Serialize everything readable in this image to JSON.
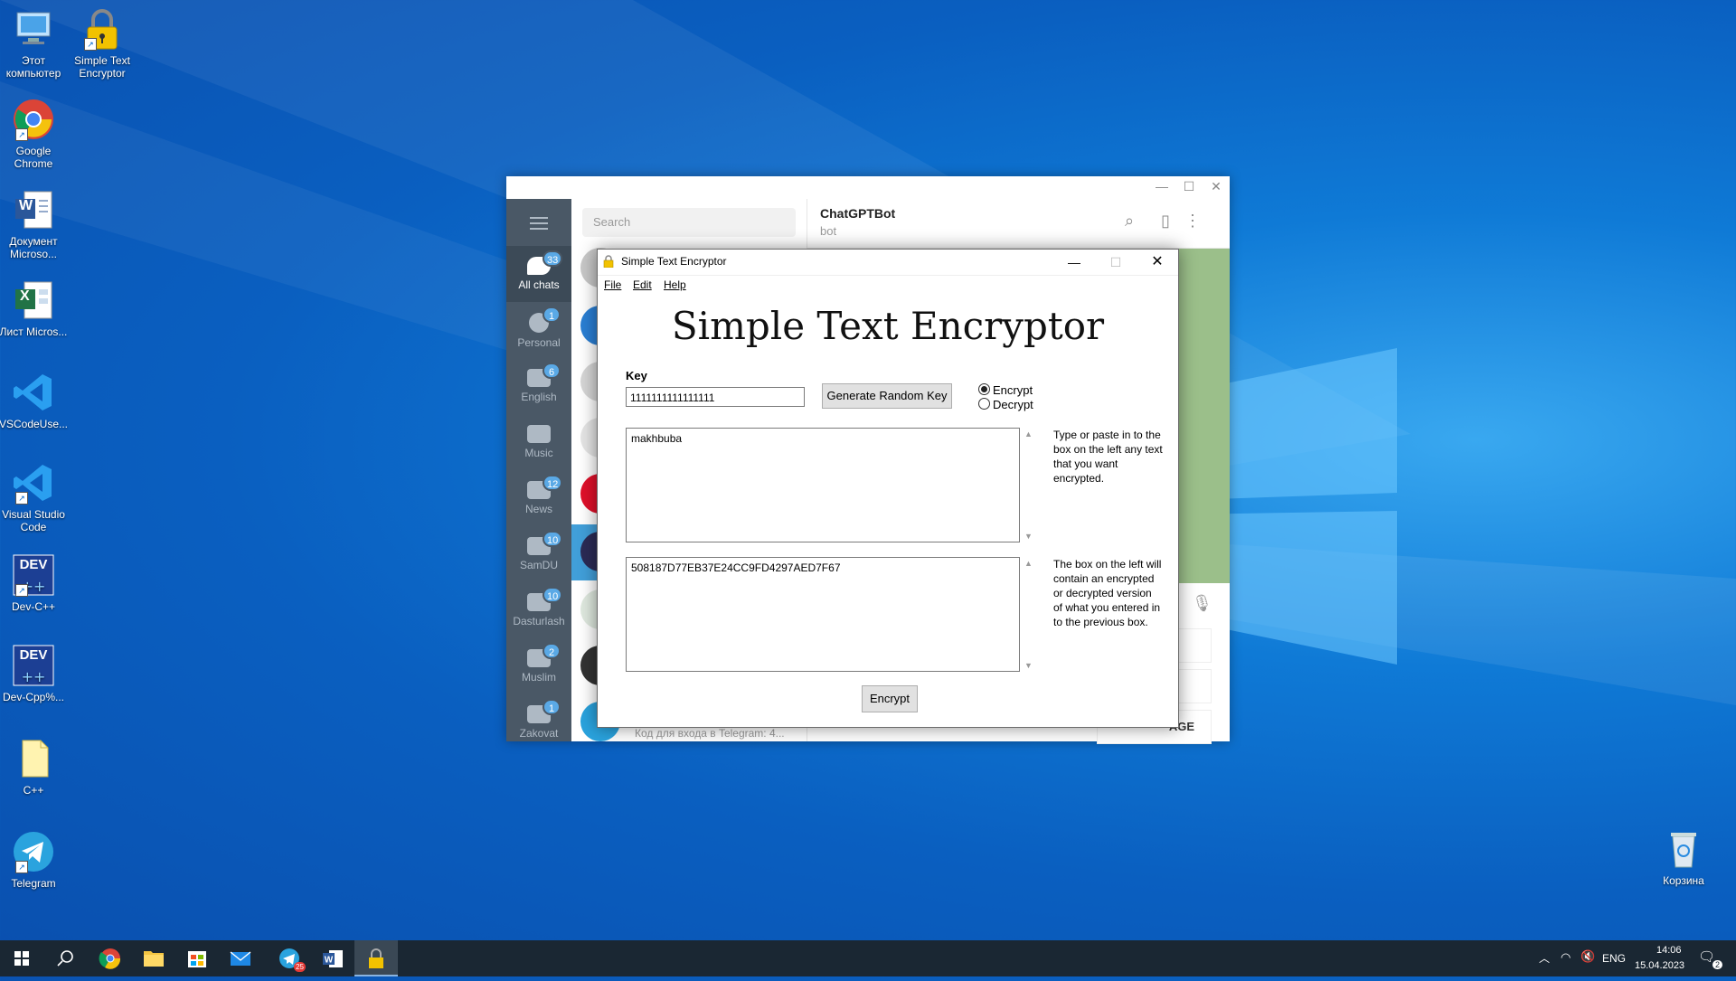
{
  "desktop": {
    "icons": [
      {
        "label": "Этот компьютер"
      },
      {
        "label": "Simple Text Encryptor"
      },
      {
        "label": "Google Chrome"
      },
      {
        "label": "Документ Microso..."
      },
      {
        "label": "Лист Micros..."
      },
      {
        "label": "VSCodeUse..."
      },
      {
        "label": "Visual Studio Code"
      },
      {
        "label": "Dev-C++"
      },
      {
        "label": "Dev-Cpp%..."
      },
      {
        "label": "C++"
      },
      {
        "label": "Telegram"
      }
    ],
    "recycle_bin": "Корзина",
    "word_icon_letter": "W",
    "excel_icon_letter": "X",
    "dev_icon_text": "DEV"
  },
  "telegram": {
    "search_placeholder": "Search",
    "chat_name": "ChatGPTBot",
    "chat_status": "bot",
    "last_message": "Код для входа в Telegram: 4...",
    "keyboard_partial": "AGE",
    "folders": [
      {
        "label": "All chats",
        "badge": "33"
      },
      {
        "label": "Personal",
        "badge": "1"
      },
      {
        "label": "English",
        "badge": "6"
      },
      {
        "label": "Music",
        "badge": ""
      },
      {
        "label": "News",
        "badge": "12"
      },
      {
        "label": "SamDU",
        "badge": "10"
      },
      {
        "label": "Dasturlash",
        "badge": "10"
      },
      {
        "label": "Muslim",
        "badge": "2"
      },
      {
        "label": "Zakovat",
        "badge": "1"
      }
    ]
  },
  "encryptor": {
    "window_title": "Simple Text Encryptor",
    "menu": {
      "file": "File",
      "edit": "Edit",
      "help": "Help"
    },
    "heading": "Simple Text Encryptor",
    "key_label": "Key",
    "key_value": "1111111111111111",
    "generate_button": "Generate Random Key",
    "mode_encrypt": "Encrypt",
    "mode_decrypt": "Decrypt",
    "selected_mode": "Encrypt",
    "input_text": "makhbuba",
    "output_text": "508187D77EB37E24CC9FD4297AED7F67",
    "help_input": "Type or paste in to the box on the left any text that you want encrypted.",
    "help_output": "The box on the left will contain an encrypted or decrypted version of what you entered in to the previous box.",
    "action_button": "Encrypt"
  },
  "taskbar": {
    "language": "ENG",
    "time": "14:06",
    "date": "15.04.2023",
    "telegram_badge": "25",
    "notification_count": "2"
  },
  "colors": {
    "desktop_blue": "#0a5fc0",
    "taskbar": "#1a2733",
    "telegram_sidebar": "#4a5866",
    "telegram_badge": "#5aa9e6",
    "button_face": "#e1e1e1"
  }
}
